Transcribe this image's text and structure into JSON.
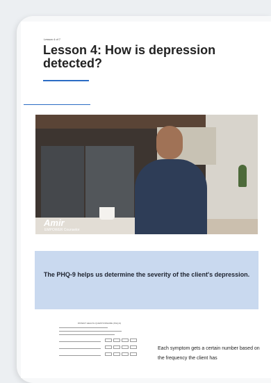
{
  "lesson": {
    "counter": "Lesson 4 of 7",
    "title": "Lesson 4: How is depression detected?"
  },
  "video": {
    "speaker_name": "Amir",
    "speaker_role": "EMPOWER Counselor"
  },
  "callout": {
    "text": "The PHQ-9 helps us determine the severity of the client's depression."
  },
  "form_thumbnail": {
    "title": "PATIENT HEALTH QUESTIONNAIRE (PHQ-9)"
  },
  "body": {
    "text": "Each symptom gets a certain number based on the frequency the client has"
  },
  "colors": {
    "accent": "#2b6cc4",
    "callout_bg": "#c9d9ef"
  }
}
